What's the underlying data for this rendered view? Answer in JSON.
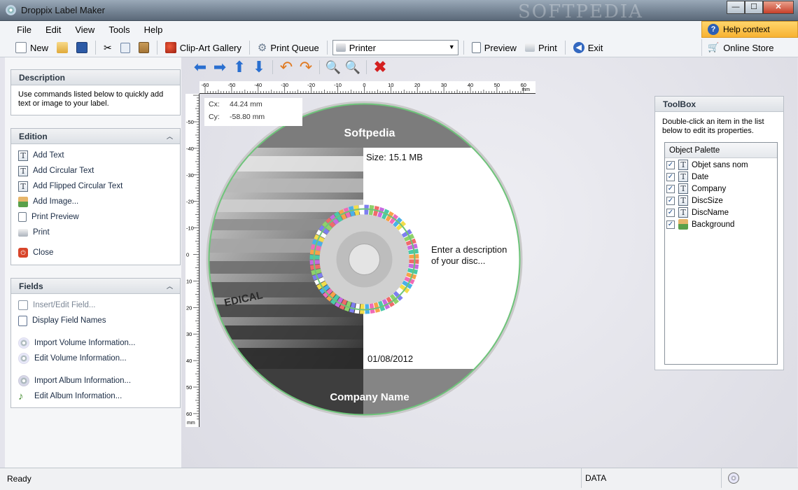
{
  "window": {
    "title": "Droppix Label Maker",
    "watermark": "SOFTPEDIA",
    "min": "—",
    "max": "☐",
    "close": "✕"
  },
  "menu": [
    "File",
    "Edit",
    "View",
    "Tools",
    "Help"
  ],
  "toolbar": {
    "new": "New",
    "clipart": "Clip-Art Gallery",
    "print_queue": "Print Queue",
    "printer": "Printer",
    "preview": "Preview",
    "print": "Print",
    "exit": "Exit"
  },
  "help_context": "Help context",
  "online_store": "Online Store",
  "panels": {
    "description": {
      "title": "Description",
      "text": "Use commands listed below to quickly add text or image to your label."
    },
    "edition": {
      "title": "Edition",
      "items": [
        "Add Text",
        "Add Circular Text",
        "Add Flipped Circular Text",
        "Add Image...",
        "Print Preview",
        "Print",
        "Close"
      ]
    },
    "fields": {
      "title": "Fields",
      "items": [
        "Insert/Edit Field...",
        "Display Field Names",
        "Import Volume Information...",
        "Edit Volume Information...",
        "Import Album Information...",
        "Edit Album Information..."
      ]
    }
  },
  "ruler": {
    "h_labels": [
      "-60",
      "-50",
      "-40",
      "-30",
      "-20",
      "-10",
      "0",
      "10",
      "20",
      "30",
      "40",
      "50",
      "60"
    ],
    "v_labels": [
      "-50",
      "-40",
      "-30",
      "-20",
      "-10",
      "0",
      "10",
      "20",
      "30",
      "40",
      "50",
      "60"
    ],
    "unit": "mm"
  },
  "coords": {
    "cx_label": "Cx:",
    "cx": "44.24 mm",
    "cy_label": "Cy:",
    "cy": "-58.80 mm"
  },
  "disc": {
    "title": "Softpedia",
    "size": "Size: 15.1 MB",
    "description": "Enter a description of your disc...",
    "date": "01/08/2012",
    "company": "Company Name",
    "folder_tab": "EDICAL"
  },
  "toolbox": {
    "title": "ToolBox",
    "text": "Double-click an item in the list below to edit its properties.",
    "palette_title": "Object Palette",
    "items": [
      "Objet sans nom",
      "Date",
      "Company",
      "DiscSize",
      "DiscName",
      "Background"
    ]
  },
  "status": {
    "ready": "Ready",
    "mode": "DATA"
  },
  "colors": {
    "accent": "#f7b232",
    "blue_arrow": "#2a6fd0",
    "orange_arrow": "#e07a22",
    "red_x": "#d42020"
  }
}
